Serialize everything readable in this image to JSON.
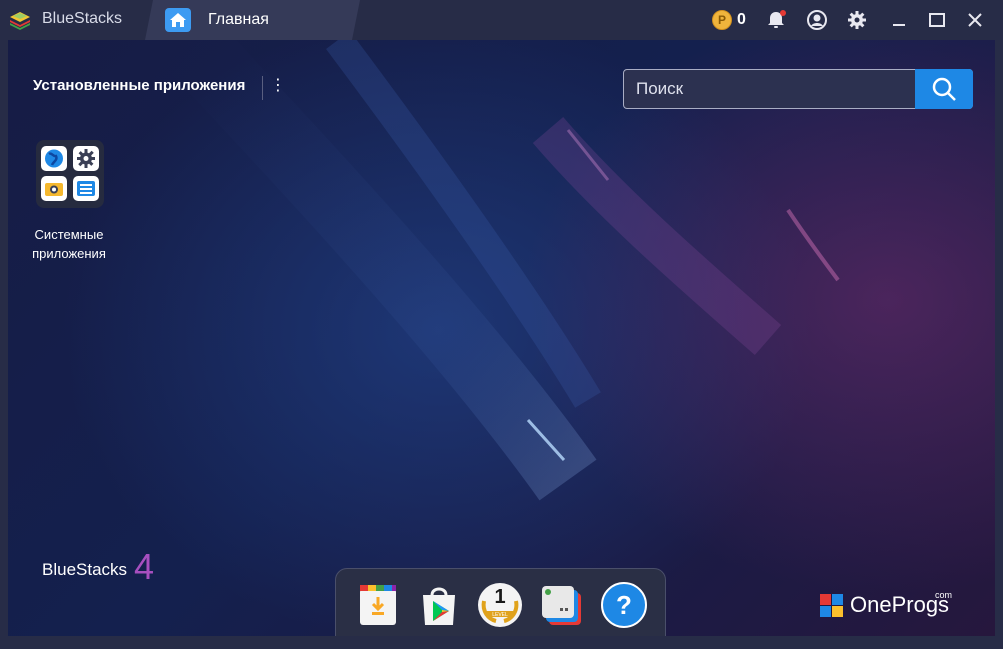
{
  "window": {
    "app_name": "BlueStacks",
    "tab_label": "Главная",
    "coin_symbol": "P",
    "coins": "0"
  },
  "icons": {
    "app_logo": "bluestacks-layers-icon",
    "home_tab": "home-icon",
    "coin": "coin-icon",
    "notifications": "bell-icon",
    "account": "user-circle-icon",
    "settings": "gear-icon",
    "minimize": "minimize-icon",
    "maximize": "maximize-icon",
    "close": "close-icon",
    "more_options": "kebab-menu-icon",
    "search": "search-icon"
  },
  "colors": {
    "titlebar": "#272c47",
    "accent": "#1e88e5",
    "notification_dot": "#e53935"
  },
  "main": {
    "section_title": "Установленные приложения",
    "more_glyph": "⋮",
    "search": {
      "placeholder": "Поиск",
      "value": ""
    },
    "apps": [
      {
        "label": "Системные приложения",
        "icon": "system-apps-folder-icon"
      }
    ],
    "brand_text": "BlueStacks",
    "brand_version": "4"
  },
  "dock": {
    "items": [
      {
        "name": "app-center-download-icon"
      },
      {
        "name": "google-play-icon"
      },
      {
        "name": "level-badge-icon",
        "value": "1",
        "badge_text": "LEVEL"
      },
      {
        "name": "multi-instance-icon"
      },
      {
        "name": "help-icon",
        "glyph": "?"
      }
    ]
  },
  "watermark": {
    "text": "OneProgs",
    "suffix": "com"
  }
}
